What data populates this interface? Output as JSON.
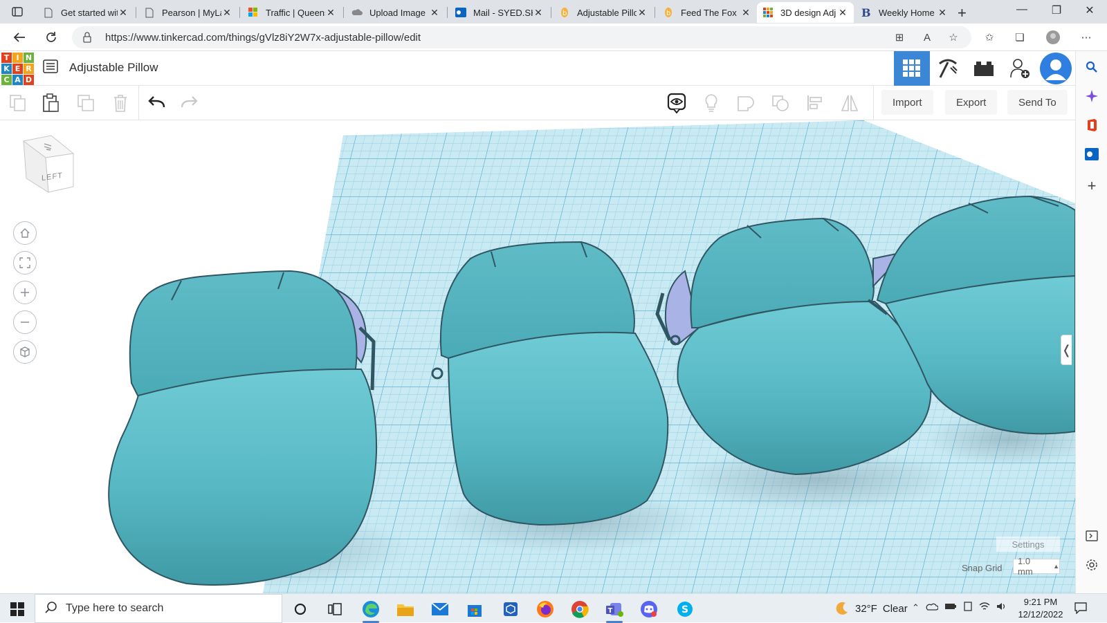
{
  "browser": {
    "tabs": [
      {
        "title": "Get started with",
        "icon": "page-icon"
      },
      {
        "title": "Pearson | MyLab",
        "icon": "page-icon"
      },
      {
        "title": "Traffic | Queens",
        "icon": "microsoft-icon"
      },
      {
        "title": "Upload Image",
        "icon": "cloud-icon"
      },
      {
        "title": "Mail - SYED.SH",
        "icon": "outlook-icon"
      },
      {
        "title": "Adjustable Pillow",
        "icon": "brainly-icon"
      },
      {
        "title": "Feed The Fox",
        "icon": "brainly-icon"
      },
      {
        "title": "3D design Adj",
        "icon": "tinkercad-icon"
      },
      {
        "title": "Weekly Home",
        "icon": "blackboard-icon"
      }
    ],
    "active_tab_index": 7,
    "url": "https://www.tinkercad.com/things/gVlz8iY2W7x-adjustable-pillow/edit"
  },
  "tinkercad": {
    "design_title": "Adjustable Pillow",
    "logo_letters": [
      "T",
      "I",
      "N",
      "K",
      "E",
      "R",
      "C",
      "A",
      "D"
    ],
    "toolbar": {
      "import_label": "Import",
      "export_label": "Export",
      "send_to_label": "Send To"
    },
    "viewcube_face": "LEFT",
    "settings_label": "Settings",
    "snap_grid_label": "Snap Grid",
    "snap_grid_value": "1.0 mm"
  },
  "taskbar": {
    "search_placeholder": "Type here to search",
    "weather_temp": "32°F",
    "weather_text": "Clear",
    "time": "9:21 PM",
    "date": "12/12/2022"
  },
  "colors": {
    "logo_red": "#e2411d",
    "logo_orange": "#f5a31a",
    "logo_green": "#6cb33e",
    "logo_blue": "#1e85c7",
    "shape_teal": "#5ec2cd",
    "shape_teal_dark": "#3f9aa5",
    "shape_outline": "#2f5662",
    "hole_lavender": "#aab3e6",
    "grid_blue": "#b9e2ef",
    "header_active": "#3b87d6"
  }
}
